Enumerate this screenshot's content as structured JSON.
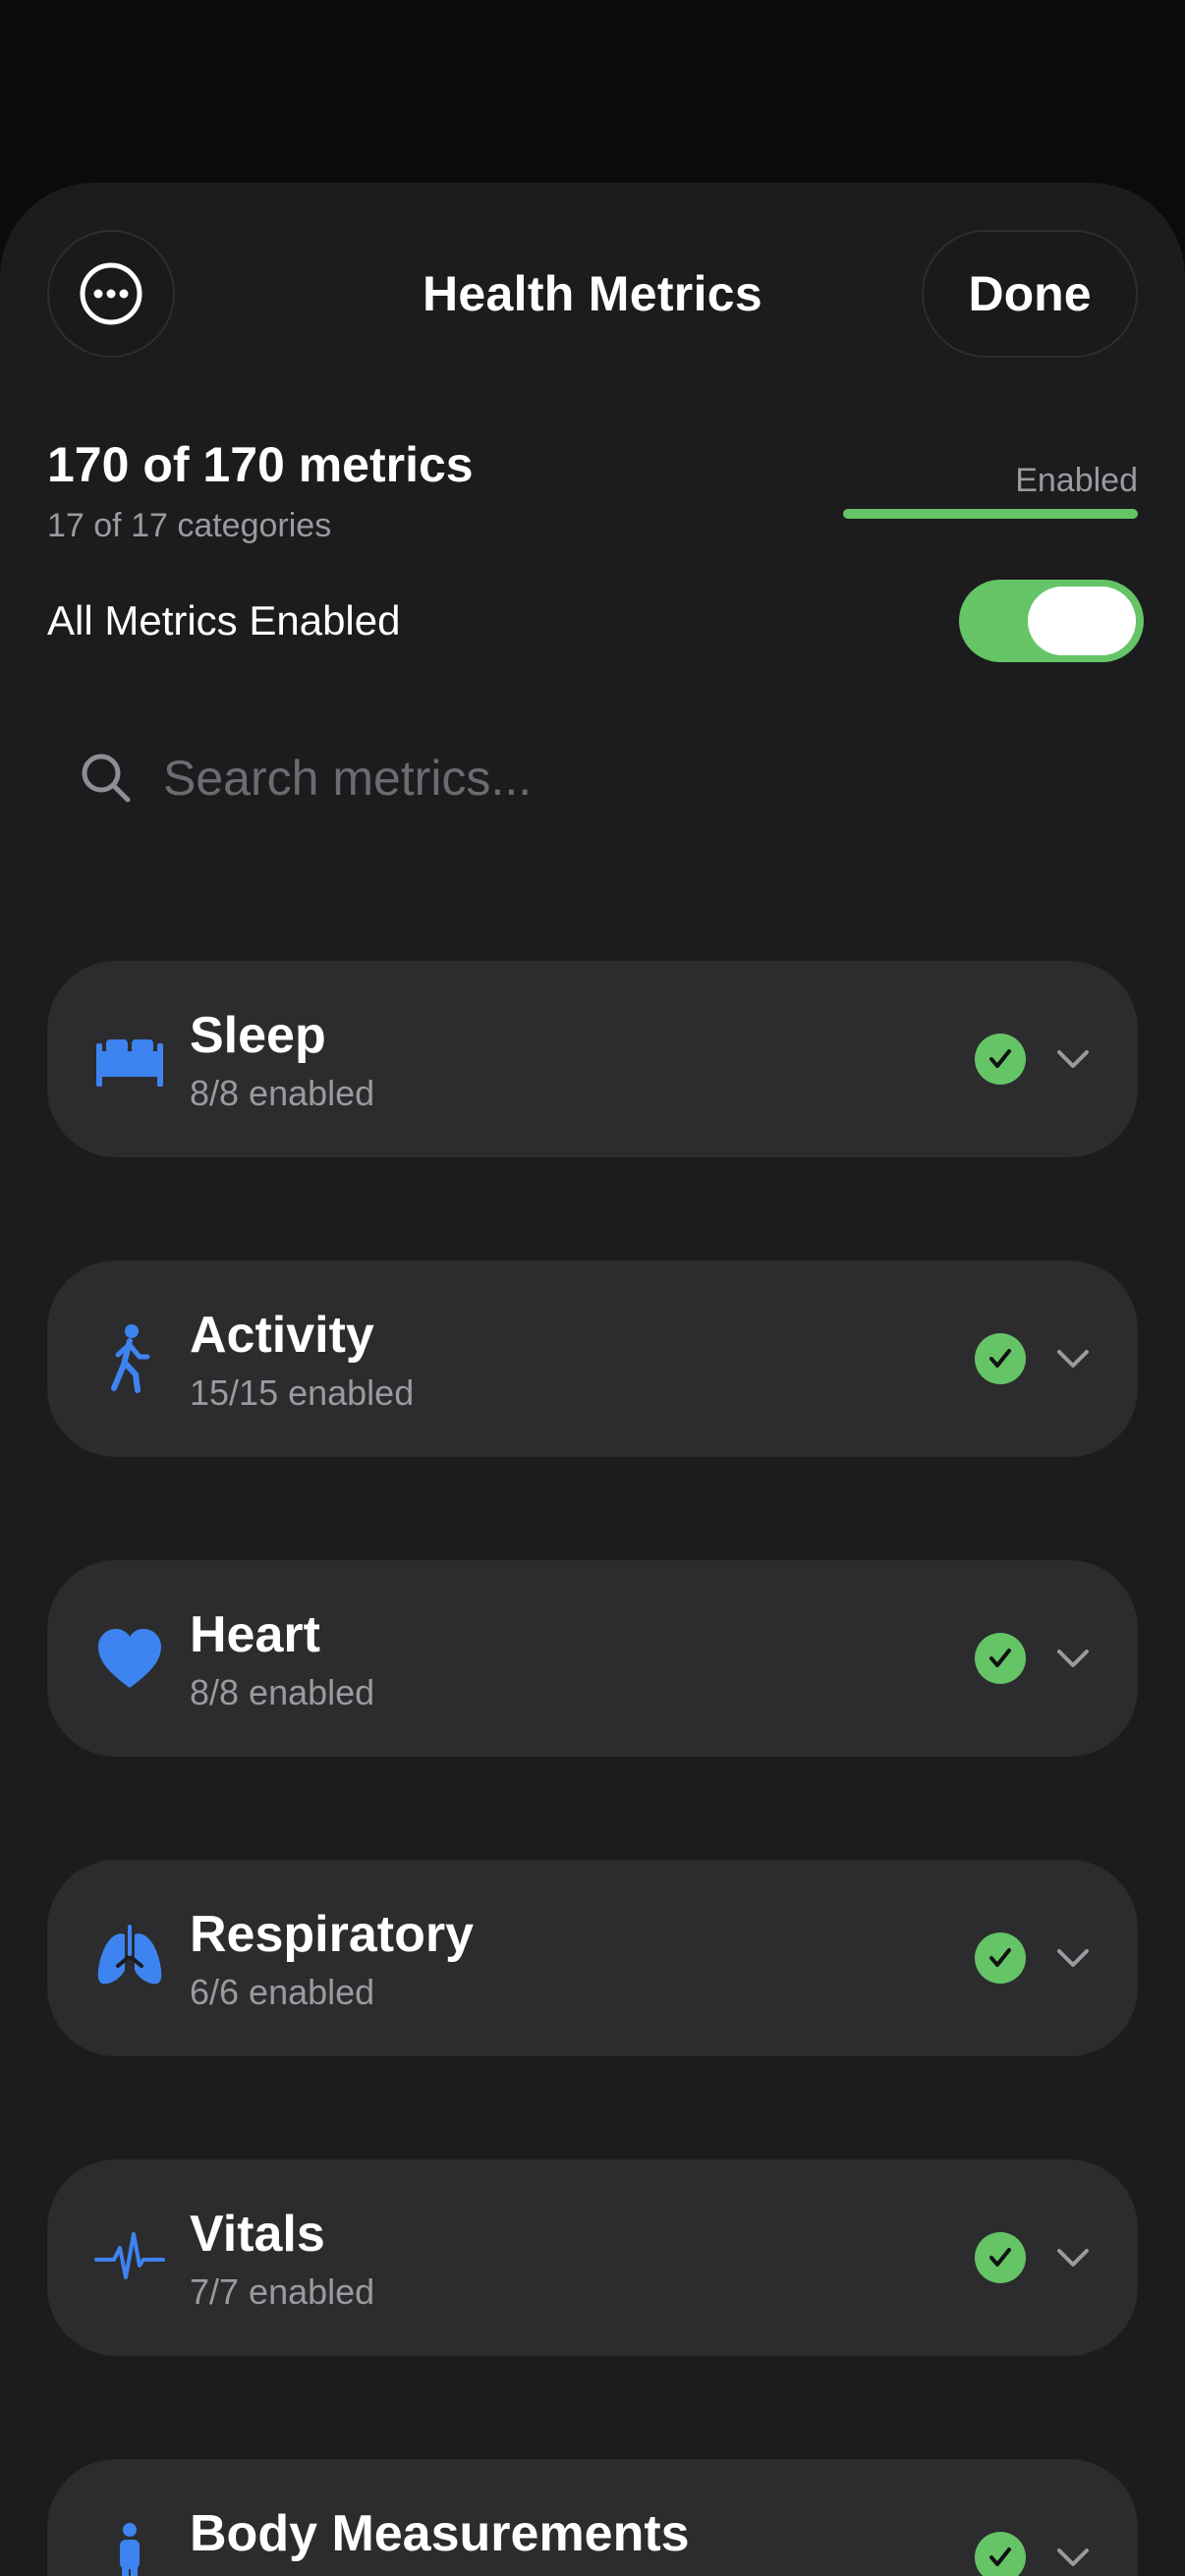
{
  "header": {
    "title": "Health Metrics",
    "done_label": "Done",
    "more_icon": "ellipsis-circle-icon"
  },
  "summary": {
    "metrics_text": "170 of 170 metrics",
    "categories_text": "17 of 17 categories",
    "status_label": "Enabled",
    "progress_fraction": 1.0
  },
  "master_toggle": {
    "label": "All Metrics Enabled",
    "on": true
  },
  "search": {
    "placeholder": "Search metrics..."
  },
  "categories": [
    {
      "name": "Sleep",
      "status": "8/8 enabled",
      "icon": "bed-icon"
    },
    {
      "name": "Activity",
      "status": "15/15 enabled",
      "icon": "walking-figure-icon"
    },
    {
      "name": "Heart",
      "status": "8/8 enabled",
      "icon": "heart-icon"
    },
    {
      "name": "Respiratory",
      "status": "6/6 enabled",
      "icon": "lungs-icon"
    },
    {
      "name": "Vitals",
      "status": "7/7 enabled",
      "icon": "waveform-icon"
    },
    {
      "name": "Body Measurements",
      "status": "",
      "icon": "figure-standing-icon"
    }
  ],
  "colors": {
    "accent_green": "#65c466",
    "icon_blue": "#3d84f0",
    "card_bg": "#2c2c2e",
    "sheet_bg": "#1c1c1e"
  }
}
